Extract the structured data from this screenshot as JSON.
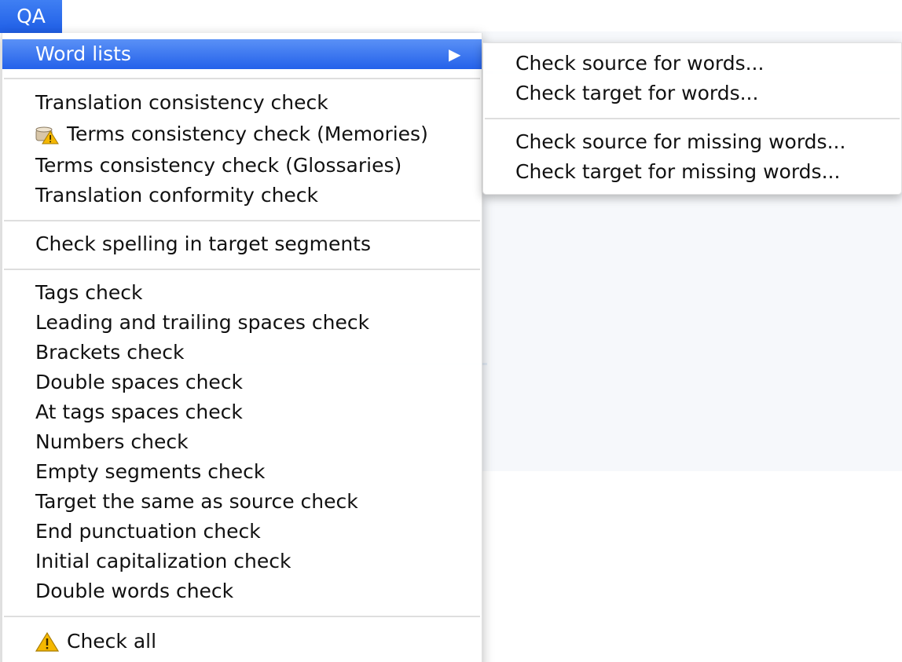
{
  "menubar": {
    "title": "QA"
  },
  "main_menu": {
    "word_lists": {
      "label": "Word lists",
      "submenu_arrow": "▶",
      "highlighted": true
    },
    "groups": [
      {
        "items": [
          {
            "label": "Translation consistency check"
          },
          {
            "label": "Terms consistency check (Memories)",
            "icon": "memory-warning-icon"
          },
          {
            "label": "Terms consistency check (Glossaries)"
          },
          {
            "label": "Translation conformity check"
          }
        ]
      },
      {
        "items": [
          {
            "label": "Check spelling in target segments"
          }
        ]
      },
      {
        "items": [
          {
            "label": "Tags check"
          },
          {
            "label": "Leading and trailing spaces check"
          },
          {
            "label": "Brackets check"
          },
          {
            "label": "Double spaces check"
          },
          {
            "label": "At tags spaces check"
          },
          {
            "label": "Numbers check"
          },
          {
            "label": "Empty segments check"
          },
          {
            "label": "Target the same as source check"
          },
          {
            "label": "End punctuation check"
          },
          {
            "label": "Initial capitalization check"
          },
          {
            "label": "Double words check"
          }
        ]
      },
      {
        "items": [
          {
            "label": "Check all",
            "icon": "warning-icon"
          }
        ]
      }
    ]
  },
  "submenu": {
    "groups": [
      {
        "items": [
          {
            "label": "Check source for words..."
          },
          {
            "label": "Check target for words..."
          }
        ]
      },
      {
        "items": [
          {
            "label": "Check source for missing words..."
          },
          {
            "label": "Check target for missing words..."
          }
        ]
      }
    ]
  },
  "colors": {
    "highlight": "#2f6ef0",
    "menubar_title_bg": "#2b6bef",
    "separator": "#dedede",
    "warning": "#f5b800"
  }
}
